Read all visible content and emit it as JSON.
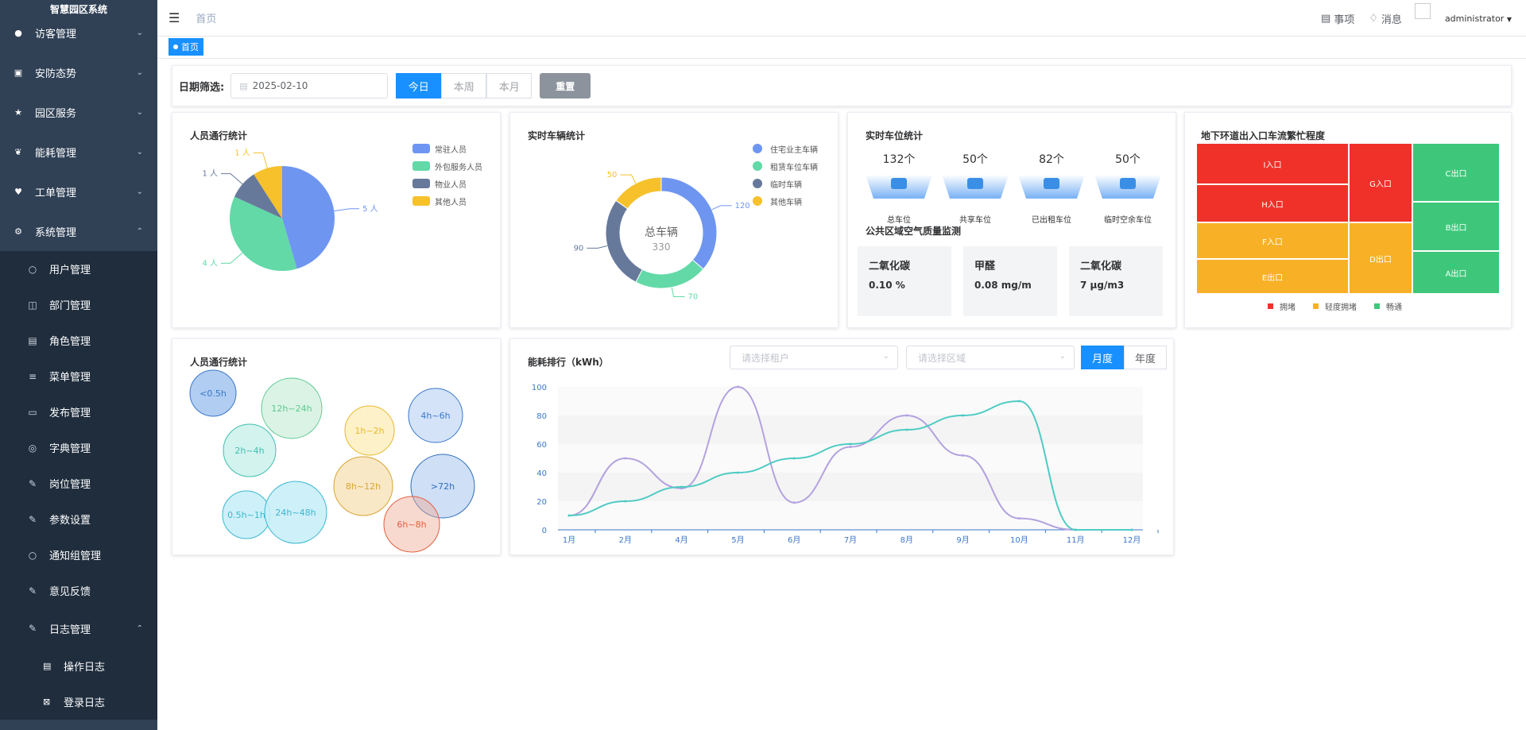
{
  "sidebar": {
    "title": "智慧园区系统",
    "items": [
      {
        "label": "访客管理",
        "icon": "user-icon"
      },
      {
        "label": "安防态势",
        "icon": "lock-icon"
      },
      {
        "label": "园区服务",
        "icon": "star-icon"
      },
      {
        "label": "能耗管理",
        "icon": "leaf-icon"
      },
      {
        "label": "工单管理",
        "icon": "heart-icon"
      },
      {
        "label": "系统管理",
        "icon": "gear-icon"
      }
    ],
    "system_sub": [
      {
        "label": "用户管理",
        "icon": "person-icon"
      },
      {
        "label": "部门管理",
        "icon": "tree-icon"
      },
      {
        "label": "角色管理",
        "icon": "peoples-icon"
      },
      {
        "label": "菜单管理",
        "icon": "menu-icon"
      },
      {
        "label": "发布管理",
        "icon": "post-icon"
      },
      {
        "label": "字典管理",
        "icon": "dict-icon"
      },
      {
        "label": "岗位管理",
        "icon": "job-icon"
      },
      {
        "label": "参数设置",
        "icon": "edit-icon"
      },
      {
        "label": "通知组管理",
        "icon": "message-icon"
      },
      {
        "label": "意见反馈",
        "icon": "form-icon"
      },
      {
        "label": "日志管理",
        "icon": "log-icon"
      }
    ],
    "log_sub": [
      {
        "label": "操作日志",
        "icon": "form-icon"
      },
      {
        "label": "登录日志",
        "icon": "logininfor-icon"
      }
    ]
  },
  "navbar": {
    "breadcrumb": "首页",
    "todo_label": "事项",
    "msg_label": "消息",
    "username": "administrator"
  },
  "tags": {
    "home": "首页"
  },
  "filter": {
    "label": "日期筛选:",
    "date": "2025-02-10",
    "today": "今日",
    "week": "本周",
    "month": "本月",
    "reset": "重置"
  },
  "people_pie": {
    "title": "人员通行统计",
    "chart_data": {
      "type": "pie",
      "categories": [
        "常驻人员",
        "外包服务人员",
        "物业人员",
        "其他人员"
      ],
      "values": [
        5,
        4,
        1,
        1
      ],
      "labels": [
        "5 人",
        "4 人",
        "1 人",
        "1 人"
      ],
      "colors": [
        "#6e96f0",
        "#62d9a7",
        "#67799b",
        "#f6c12b"
      ]
    }
  },
  "vehicle_donut": {
    "title": "实时车辆统计",
    "center_label": "总车辆",
    "center_value": "330",
    "chart_data": {
      "type": "pie",
      "categories": [
        "住宅业主车辆",
        "租赁车位车辆",
        "临时车辆",
        "其他车辆"
      ],
      "values": [
        120,
        70,
        90,
        50
      ],
      "labels": [
        "120",
        "70",
        "90",
        "50"
      ],
      "colors": [
        "#6e96f0",
        "#62d9a7",
        "#67799b",
        "#f6c12b"
      ]
    }
  },
  "parking": {
    "title": "实时车位统计",
    "cells": [
      {
        "value": "132个",
        "caption": "总车位"
      },
      {
        "value": "50个",
        "caption": "共享车位"
      },
      {
        "value": "82个",
        "caption": "已出租车位"
      },
      {
        "value": "50个",
        "caption": "临时空余车位"
      }
    ],
    "air_title": "公共区域空气质量监测",
    "air": [
      {
        "name": "二氧化碳",
        "value": "0.10 %"
      },
      {
        "name": "甲醛",
        "value": "0.08 mg/m"
      },
      {
        "name": "二氧化碳",
        "value": "7 μg/m3"
      }
    ]
  },
  "treemap": {
    "title": "地下环道出入口车流繁忙程度",
    "cells": [
      "I入口",
      "H入口",
      "G入口",
      "C出口",
      "B出口",
      "F入口",
      "E出口",
      "D出口",
      "A出口"
    ],
    "legend": [
      "拥堵",
      "轻度拥堵",
      "畅通"
    ],
    "colors": [
      "#f0312a",
      "#f8b126",
      "#3ec77a"
    ]
  },
  "bubbles": {
    "title": "人员通行统计",
    "items": [
      "<0.5h",
      "12h~24h",
      "1h~2h",
      "4h~6h",
      "2h~4h",
      "8h~12h",
      ">72h",
      "0.5h~1h",
      "24h~48h",
      "6h~8h"
    ]
  },
  "energy": {
    "title": "能耗排行（kWh）",
    "tenant_placeholder": "请选择租户",
    "area_placeholder": "请选择区域",
    "month_btn": "月度",
    "year_btn": "年度",
    "chart_data": {
      "type": "line",
      "categories": [
        "1月",
        "2月",
        "4月",
        "5月",
        "6月",
        "7月",
        "8月",
        "9月",
        "10月",
        "11月",
        "12月"
      ],
      "ylim": [
        0,
        100
      ],
      "yticks": [
        0,
        20,
        40,
        60,
        80,
        100
      ],
      "series": [
        {
          "values": [
            10,
            50,
            29,
            100,
            19,
            58,
            80,
            52,
            8,
            0,
            0
          ],
          "color": "#b3a2df"
        },
        {
          "values": [
            10,
            20,
            30,
            40,
            50,
            60,
            70,
            80,
            90,
            0,
            0
          ],
          "color": "#4ecbc4"
        }
      ]
    }
  }
}
